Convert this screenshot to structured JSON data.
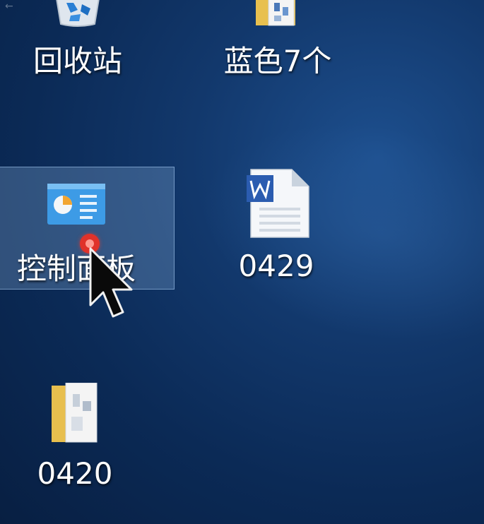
{
  "desktop": {
    "icons": [
      {
        "label": "回收站",
        "icon": "recycle-bin-icon"
      },
      {
        "label": "蓝色7个",
        "icon": "folder-icon"
      },
      {
        "label": "控制面板",
        "icon": "control-panel-icon"
      },
      {
        "label": "0429",
        "icon": "word-document-icon"
      },
      {
        "label": "0420",
        "icon": "folder-icon"
      }
    ],
    "selected_item": "控制面板",
    "back_glyph": "←"
  }
}
